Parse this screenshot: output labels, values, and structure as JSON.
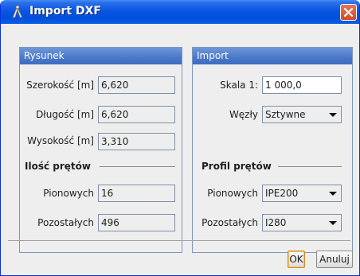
{
  "window": {
    "title": "Import DXF"
  },
  "rysunek": {
    "title": "Rysunek",
    "szerokosc": {
      "label": "Szerokość [m]",
      "value": "6,620"
    },
    "dlugosc": {
      "label": "Długość [m]",
      "value": "6,620"
    },
    "wysokosc": {
      "label": "Wysokość [m]",
      "value": "3,310"
    },
    "ilosc_section": "Ilość prętów",
    "pionowych": {
      "label": "Pionowych",
      "value": "16"
    },
    "pozostalych": {
      "label": "Pozostałych",
      "value": "496"
    }
  },
  "import": {
    "title": "Import",
    "skala": {
      "label": "Skala 1:",
      "value": "1 000,0"
    },
    "wezly": {
      "label": "Węzły",
      "value": "Sztywne"
    },
    "profil_section": "Profil prętów",
    "pionowych": {
      "label": "Pionowych",
      "value": "IPE200"
    },
    "pozostalych": {
      "label": "Pozostałych",
      "value": "I280"
    }
  },
  "buttons": {
    "ok": "OK",
    "cancel": "Anuluj"
  },
  "icons": {
    "title": "compass-icon",
    "close": "close-icon",
    "dropdown": "chevron-down-icon"
  },
  "colors": {
    "titlebar": "#0a55e2",
    "panel_header": "#4a78c9",
    "close": "#d44a26"
  }
}
